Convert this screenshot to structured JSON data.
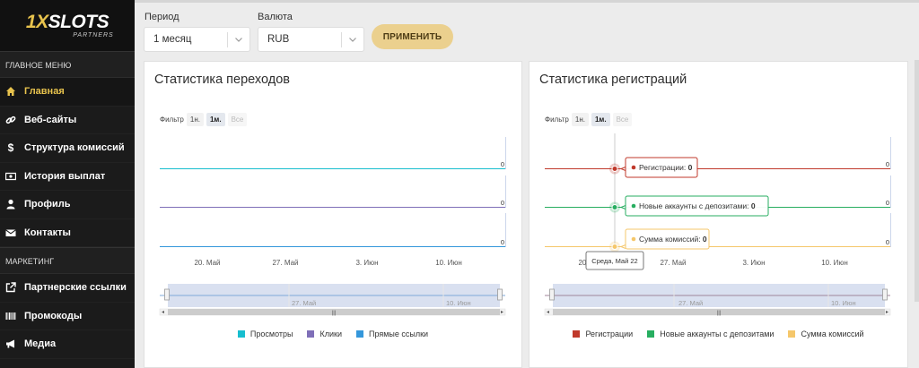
{
  "brand": {
    "logo_prefix": "1X",
    "logo_main": "SLOTS",
    "logo_sub": "PARTNERS"
  },
  "sidebar": {
    "main_header": "ГЛАВНОЕ МЕНЮ",
    "main_items": [
      {
        "label": "Главная",
        "icon": "home-icon",
        "active": true
      },
      {
        "label": "Веб-сайты",
        "icon": "link-icon"
      },
      {
        "label": "Структура комиссий",
        "icon": "dollar-icon"
      },
      {
        "label": "История выплат",
        "icon": "money-icon"
      },
      {
        "label": "Профиль",
        "icon": "user-icon"
      },
      {
        "label": "Контакты",
        "icon": "envelope-icon"
      }
    ],
    "marketing_header": "МАРКЕТИНГ",
    "marketing_items": [
      {
        "label": "Партнерские ссылки",
        "icon": "external-link-icon"
      },
      {
        "label": "Промокоды",
        "icon": "barcode-icon"
      },
      {
        "label": "Медиа",
        "icon": "megaphone-icon"
      }
    ]
  },
  "filters": {
    "period_label": "Период",
    "period_value": "1 месяц",
    "currency_label": "Валюта",
    "currency_value": "RUB",
    "apply_label": "ПРИМЕНИТЬ"
  },
  "colors": {
    "accent": "#e8c34d",
    "views": "#17becf",
    "clicks": "#7f6fb8",
    "direct": "#3497db",
    "registrations": "#c0392b",
    "new_deposit_accounts": "#27ae60",
    "commission_sum": "#f5c76b"
  },
  "chart_transitions": {
    "title": "Статистика переходов",
    "filter_label": "Фильтр",
    "filter_buttons": [
      "1н.",
      "1м.",
      "Все"
    ],
    "selected_filter": "1м.",
    "x_ticks": [
      "20. Май",
      "27. Май",
      "3. Июн",
      "10. Июн"
    ],
    "navigator_ticks": [
      "27. Май",
      "10. Июн"
    ],
    "series_end_labels": [
      "0",
      "0",
      "0"
    ],
    "legend": [
      "Просмотры",
      "Клики",
      "Прямые ссылки"
    ]
  },
  "chart_registrations": {
    "title": "Статистика регистраций",
    "filter_label": "Фильтр",
    "filter_buttons": [
      "1н.",
      "1м.",
      "Все"
    ],
    "selected_filter": "1м.",
    "x_ticks": [
      "20.",
      "27. Май",
      "3. Июн",
      "10. Июн"
    ],
    "navigator_ticks": [
      "27. Май",
      "10. Июн"
    ],
    "series_end_labels": [
      "0",
      "0",
      "0"
    ],
    "tooltips": [
      "Регистрации:",
      "Новые аккаунты с депозитами:",
      "Сумма комиссий:"
    ],
    "tooltip_values": [
      "0",
      "0",
      "0"
    ],
    "date_tooltip": "Среда, Май 22",
    "legend": [
      "Регистрации",
      "Новые аккаунты с депозитами",
      "Сумма комиссий"
    ]
  },
  "chart_data": [
    {
      "type": "line",
      "title": "Статистика переходов",
      "x": [
        "20. Май",
        "27. Май",
        "3. Июн",
        "10. Июн"
      ],
      "series": [
        {
          "name": "Просмотры",
          "values": [
            0,
            0,
            0,
            0
          ]
        },
        {
          "name": "Клики",
          "values": [
            0,
            0,
            0,
            0
          ]
        },
        {
          "name": "Прямые ссылки",
          "values": [
            0,
            0,
            0,
            0
          ]
        }
      ],
      "legend_position": "bottom"
    },
    {
      "type": "line",
      "title": "Статистика регистраций",
      "x": [
        "20. Май",
        "27. Май",
        "3. Июн",
        "10. Июн"
      ],
      "series": [
        {
          "name": "Регистрации",
          "values": [
            0,
            0,
            0,
            0
          ]
        },
        {
          "name": "Новые аккаунты с депозитами",
          "values": [
            0,
            0,
            0,
            0
          ]
        },
        {
          "name": "Сумма комиссий",
          "values": [
            0,
            0,
            0,
            0
          ]
        }
      ],
      "legend_position": "bottom"
    }
  ]
}
